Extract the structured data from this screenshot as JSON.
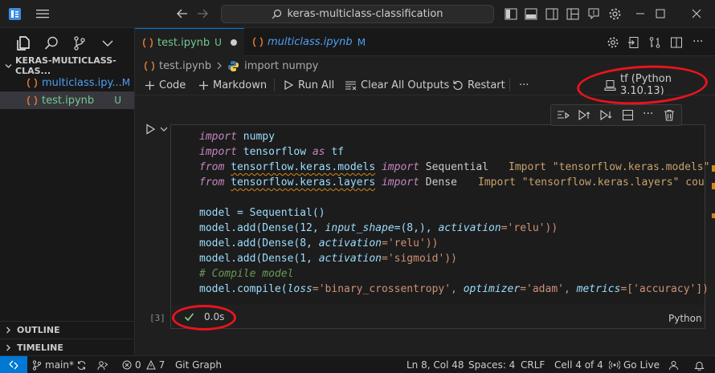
{
  "titlebar": {
    "search_text": "keras-multiclass-classification"
  },
  "sidebar": {
    "section_title": "KERAS-MULTICLASS-CLAS...",
    "files": [
      {
        "name": "multiclass.ipy...",
        "tag": "M",
        "color": "#4d9ef2",
        "tag_color": "#4d9ef2"
      },
      {
        "name": "test.ipynb",
        "tag": "U",
        "color": "#73c991",
        "tag_color": "#73c991"
      }
    ],
    "outline_label": "OUTLINE",
    "timeline_label": "TIMELINE"
  },
  "tabs": [
    {
      "label": "test.ipynb",
      "tag": "U",
      "color": "#73c991"
    },
    {
      "label": "multiclass.ipynb",
      "tag": "M",
      "color": "#4d9ef2"
    }
  ],
  "breadcrumb": {
    "file": "test.ipynb",
    "symbol": "import numpy"
  },
  "toolbar": {
    "code": "Code",
    "markdown": "Markdown",
    "run_all": "Run All",
    "clear_outputs": "Clear All Outputs",
    "restart": "Restart",
    "more": "···",
    "kernel": "tf (Python 3.10.13)"
  },
  "cell": {
    "exec_count": "[3]",
    "duration": "0.0s",
    "language": "Python",
    "code": {
      "l1_kw": "import",
      "l1_mod": " numpy",
      "l2_kw": "import",
      "l2_mod": " tensorflow",
      "l2_as": " as",
      "l2_alias": " tf",
      "l3_kw": "from",
      "l3_mod": "tensorflow.keras.models",
      "l3_imp": "import",
      "l3_name": " Sequential",
      "l3_hint": "Import \"tensorflow.keras.models\"",
      "l4_kw": "from",
      "l4_mod": "tensorflow.keras.layers",
      "l4_imp": "import",
      "l4_name": " Dense",
      "l4_hint": "Import \"tensorflow.keras.layers\" cou",
      "l6": "model = Sequential()",
      "l7a": "model.add(Dense(12, ",
      "l7b": "input_shape",
      "l7c": "=(8,), ",
      "l7d": "activation",
      "l7e": "='relu'))",
      "l8a": "model.add(Dense(8, ",
      "l8b": "activation",
      "l8c": "='relu'))",
      "l9a": "model.add(Dense(1, ",
      "l9b": "activation",
      "l9c": "='sigmoid'))",
      "l10": "# Compile model",
      "l11a": "model.compile(",
      "l11b": "loss",
      "l11c": "='binary_crossentropy', ",
      "l11d": "optimizer",
      "l11e": "='adam', ",
      "l11f": "metrics",
      "l11g": "=['accuracy'])"
    }
  },
  "statusbar": {
    "branch": "main*",
    "problems_errors": "0",
    "problems_warnings": "7",
    "git_graph": "Git Graph",
    "position": "Ln 8, Col 48",
    "spaces": "Spaces: 4",
    "eol": "CRLF",
    "cell_info": "Cell 4 of 4",
    "go_live": "Go Live"
  },
  "colors": {
    "accent": "#0078d4",
    "annotation": "#e8141e",
    "warning": "#d18616"
  }
}
